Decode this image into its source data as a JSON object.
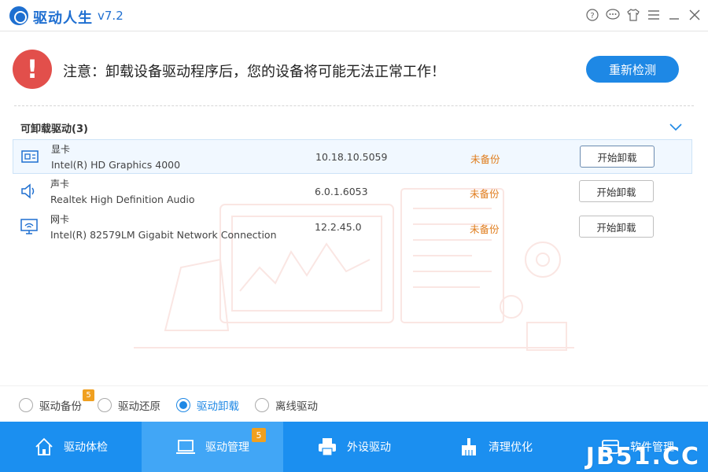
{
  "titlebar": {
    "app_name": "驱动人生",
    "version": "v7.2",
    "icons": [
      "help-icon",
      "feedback-icon",
      "skin-icon",
      "menu-icon",
      "minimize-icon",
      "close-icon"
    ]
  },
  "warning": {
    "icon": "!",
    "message": "注意：卸载设备驱动程序后，您的设备将可能无法正常工作！",
    "recheck_label": "重新检测"
  },
  "section": {
    "title": "可卸载驱动(3)"
  },
  "drivers": [
    {
      "category": "显卡",
      "model": "Intel(R) HD Graphics 4000",
      "version": "10.18.10.5059",
      "status": "未备份",
      "button": "开始卸载",
      "icon": "display-card-icon"
    },
    {
      "category": "声卡",
      "model": "Realtek High Definition Audio",
      "version": "6.0.1.6053",
      "status": "未备份",
      "button": "开始卸载",
      "icon": "speaker-icon"
    },
    {
      "category": "网卡",
      "model": "Intel(R) 82579LM Gigabit Network Connection",
      "version": "12.2.45.0",
      "status": "未备份",
      "button": "开始卸载",
      "icon": "network-card-icon"
    }
  ],
  "modes": [
    {
      "label": "驱动备份",
      "selected": false,
      "badge": "5"
    },
    {
      "label": "驱动还原",
      "selected": false
    },
    {
      "label": "驱动卸载",
      "selected": true
    },
    {
      "label": "离线驱动",
      "selected": false
    }
  ],
  "nav": [
    {
      "label": "驱动体检",
      "icon": "home-icon",
      "active": false
    },
    {
      "label": "驱动管理",
      "icon": "laptop-icon",
      "active": true,
      "badge": "5"
    },
    {
      "label": "外设驱动",
      "icon": "printer-icon",
      "active": false
    },
    {
      "label": "清理优化",
      "icon": "broom-icon",
      "active": false
    },
    {
      "label": "软件管理",
      "icon": "box-icon",
      "active": false
    }
  ],
  "watermark": "JB51.CC",
  "colors": {
    "accent": "#1e88e5",
    "nav_bg": "#1b8ff0",
    "warning": "#e24f4b",
    "status": "#e07d1d",
    "badge": "#f0a020"
  }
}
